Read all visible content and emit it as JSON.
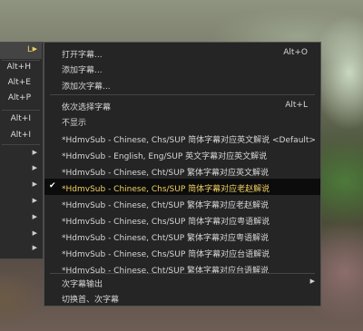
{
  "parent_menu": {
    "rows": [
      {
        "accel": "L",
        "arrow": "▶",
        "active": true
      },
      {
        "accel": "Alt+H"
      },
      {
        "accel": "Alt+E"
      },
      {
        "accel": "Alt+P"
      },
      {
        "accel": "Alt+I"
      },
      {
        "accel": "Alt+I"
      },
      {
        "arrow": "▶"
      },
      {
        "arrow": "▶"
      },
      {
        "arrow": "▶"
      },
      {
        "arrow": "▶"
      },
      {
        "arrow": "▶"
      },
      {
        "arrow": "▶"
      },
      {
        "arrow": "▶"
      }
    ]
  },
  "menu": {
    "open_subtitle": {
      "label": "打开字幕...",
      "accel": "Alt+O"
    },
    "add_subtitle": {
      "label": "添加字幕..."
    },
    "add_secondary": {
      "label": "添加次字幕..."
    },
    "cycle_subtitle": {
      "label": "依次选择字幕",
      "accel": "Alt+L"
    },
    "hide": {
      "label": "不显示"
    },
    "tracks": [
      "*HdmvSub - Chinese, Chs/SUP  简体字幕对应英文解说 <Default>",
      "*HdmvSub - English, Eng/SUP  英文字幕对应英文解说",
      "*HdmvSub - Chinese, Cht/SUP  繁体字幕对应英文解说",
      "*HdmvSub - Chinese, Chs/SUP  简体字幕对应老赵解说",
      "*HdmvSub - Chinese, Cht/SUP  繁体字幕对应老赵解说",
      "*HdmvSub - Chinese, Chs/SUP  简体字幕对应粤语解说",
      "*HdmvSub - Chinese, Cht/SUP  繁体字幕对应粤语解说",
      "*HdmvSub - Chinese, Chs/SUP  简体字幕对应台语解说",
      "*HdmvSub - Chinese, Cht/SUP  繁体字幕对应台语解说"
    ],
    "checked_track": 3,
    "check_mark": "✔",
    "output": {
      "label": "次字幕输出",
      "arrow": "▶"
    },
    "switch": {
      "label": "切换首、次字幕"
    }
  }
}
